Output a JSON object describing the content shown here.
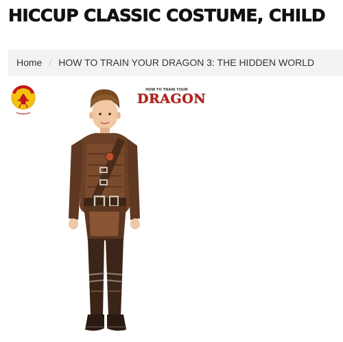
{
  "product": {
    "title": "HICCUP CLASSIC COSTUME, CHILD"
  },
  "breadcrumb": {
    "items": [
      {
        "label": "Home"
      },
      {
        "label": "HOW TO TRAIN YOUR DRAGON 3: THE HIDDEN WORLD"
      }
    ],
    "separator": "/"
  },
  "image": {
    "brand_badge_text": "RUBIES",
    "franchise_logo_small": "HOW TO TRAIN YOUR",
    "franchise_logo_big": "DRAGON"
  },
  "colors": {
    "breadcrumb_bg": "#f3f3f3",
    "logo_red": "#b5221b",
    "badge_yellow": "#f4c20d"
  }
}
